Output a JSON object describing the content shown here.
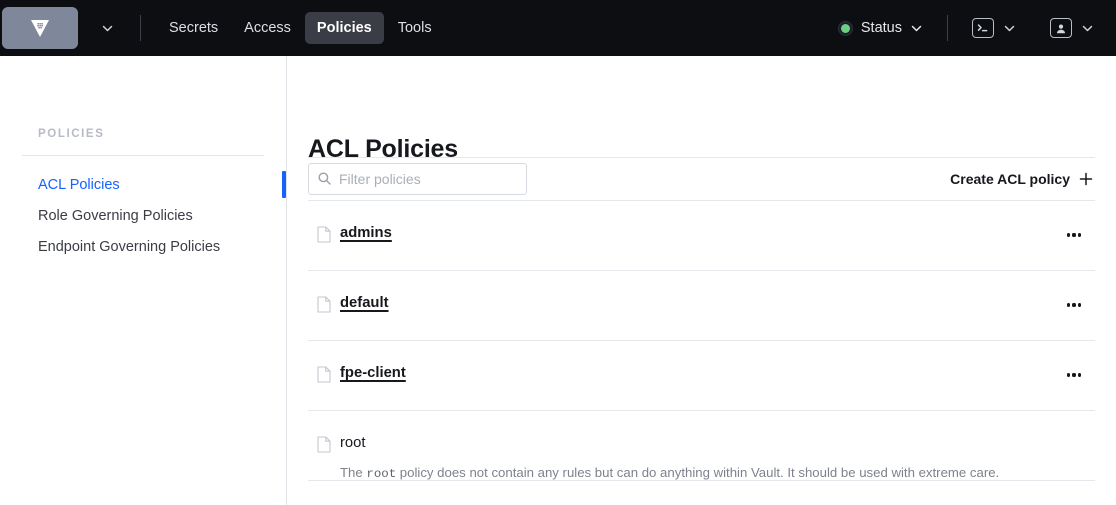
{
  "navbar": {
    "logo_icon": "vault-logo-icon",
    "logo_dropdown_icon": "chevron-down-icon",
    "links": [
      {
        "label": "Secrets",
        "active": false
      },
      {
        "label": "Access",
        "active": false
      },
      {
        "label": "Policies",
        "active": true
      },
      {
        "label": "Tools",
        "active": false
      }
    ],
    "status": {
      "label": "Status",
      "dot_color": "#6bcf84",
      "chevron_icon": "chevron-down-icon"
    },
    "console": {
      "icon": "terminal-icon",
      "chevron_icon": "chevron-down-icon"
    },
    "user": {
      "icon": "user-icon",
      "chevron_icon": "chevron-down-icon"
    },
    "bg_color": "#0d0e12",
    "active_tab_bg": "#3b3d46"
  },
  "sidebar": {
    "heading": "POLICIES",
    "items": [
      {
        "label": "ACL Policies",
        "active": true
      },
      {
        "label": "Role Governing Policies",
        "active": false
      },
      {
        "label": "Endpoint Governing Policies",
        "active": false
      }
    ],
    "active_color": "#1563ff"
  },
  "main": {
    "title": "ACL Policies",
    "toolbar": {
      "filter_placeholder": "Filter policies",
      "filter_value": "",
      "search_icon": "search-icon",
      "create_label": "Create ACL policy",
      "create_icon": "plus-icon"
    },
    "policies": [
      {
        "name": "admins",
        "is_link": true,
        "icon": "document-icon",
        "description": "",
        "has_menu": true
      },
      {
        "name": "default",
        "is_link": true,
        "icon": "document-icon",
        "description": "",
        "has_menu": true
      },
      {
        "name": "fpe-client",
        "is_link": true,
        "icon": "document-icon",
        "description": "",
        "has_menu": true
      },
      {
        "name": "root",
        "is_link": false,
        "icon": "document-icon",
        "description_prefix": "The ",
        "description_mono": "root",
        "description_suffix": " policy does not contain any rules but can do anything within Vault. It should be used with extreme care.",
        "has_menu": false
      }
    ]
  }
}
